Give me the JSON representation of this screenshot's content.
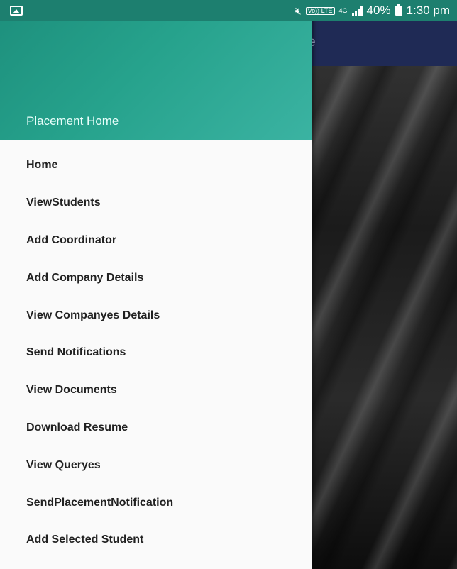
{
  "status_bar": {
    "left_icon": "image-icon",
    "network": "4G",
    "volte": "Vo)) LTE",
    "battery": "40%",
    "time": "1:30 pm"
  },
  "app": {
    "title_fragment": "e"
  },
  "drawer": {
    "header_title": "Placement Home",
    "items": [
      {
        "label": "Home"
      },
      {
        "label": "ViewStudents"
      },
      {
        "label": "Add Coordinator"
      },
      {
        "label": "Add Company Details"
      },
      {
        "label": "View Companyes Details"
      },
      {
        "label": "Send Notifications"
      },
      {
        "label": "View Documents"
      },
      {
        "label": "Download Resume"
      },
      {
        "label": "View Queryes"
      },
      {
        "label": "SendPlacementNotification"
      },
      {
        "label": "Add Selected Student"
      }
    ]
  },
  "colors": {
    "status_bar": "#1d7f6f",
    "drawer_header": "#26a28c",
    "toolbar": "#1f2a55",
    "drawer_bg": "#fafafa"
  }
}
